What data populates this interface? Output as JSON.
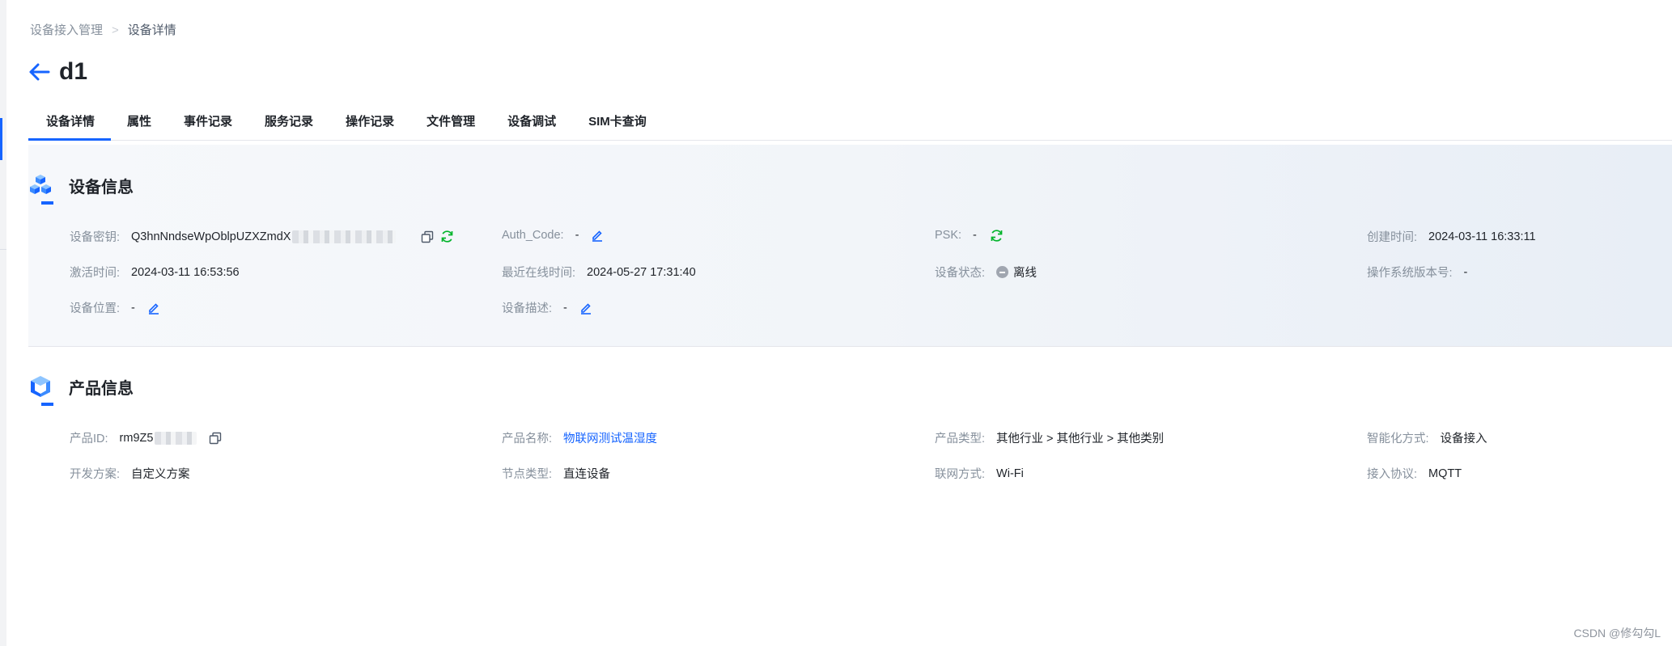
{
  "breadcrumb": {
    "parent": "设备接入管理",
    "separator": ">",
    "current": "设备详情"
  },
  "page_title": "d1",
  "tabs": [
    "设备详情",
    "属性",
    "事件记录",
    "服务记录",
    "操作记录",
    "文件管理",
    "设备调试",
    "SIM卡查询"
  ],
  "device_info": {
    "title": "设备信息",
    "secret_label": "设备密钥:",
    "secret_value": "Q3hnNndseWpOblpUZXZmdX",
    "auth_code_label": "Auth_Code:",
    "auth_code_value": "-",
    "psk_label": "PSK:",
    "psk_value": "-",
    "created_label": "创建时间:",
    "created_value": "2024-03-11 16:33:11",
    "activated_label": "激活时间:",
    "activated_value": "2024-03-11 16:53:56",
    "last_online_label": "最近在线时间:",
    "last_online_value": "2024-05-27 17:31:40",
    "status_label": "设备状态:",
    "status_value": "离线",
    "os_version_label": "操作系统版本号:",
    "os_version_value": "-",
    "location_label": "设备位置:",
    "location_value": "-",
    "description_label": "设备描述:",
    "description_value": "-"
  },
  "product_info": {
    "title": "产品信息",
    "product_id_label": "产品ID:",
    "product_id_value": "rm9Z5",
    "product_name_label": "产品名称:",
    "product_name_value": "物联网测试温湿度",
    "product_type_label": "产品类型:",
    "product_type_value": "其他行业 > 其他行业 > 其他类别",
    "smart_mode_label": "智能化方式:",
    "smart_mode_value": "设备接入",
    "dev_plan_label": "开发方案:",
    "dev_plan_value": "自定义方案",
    "node_type_label": "节点类型:",
    "node_type_value": "直连设备",
    "network_label": "联网方式:",
    "network_value": "Wi-Fi",
    "protocol_label": "接入协议:",
    "protocol_value": "MQTT"
  },
  "colors": {
    "accent": "#1664ff",
    "refresh": "#00b42a",
    "offline": "#a0a6b0"
  },
  "watermark": "CSDN @修勾勾L"
}
